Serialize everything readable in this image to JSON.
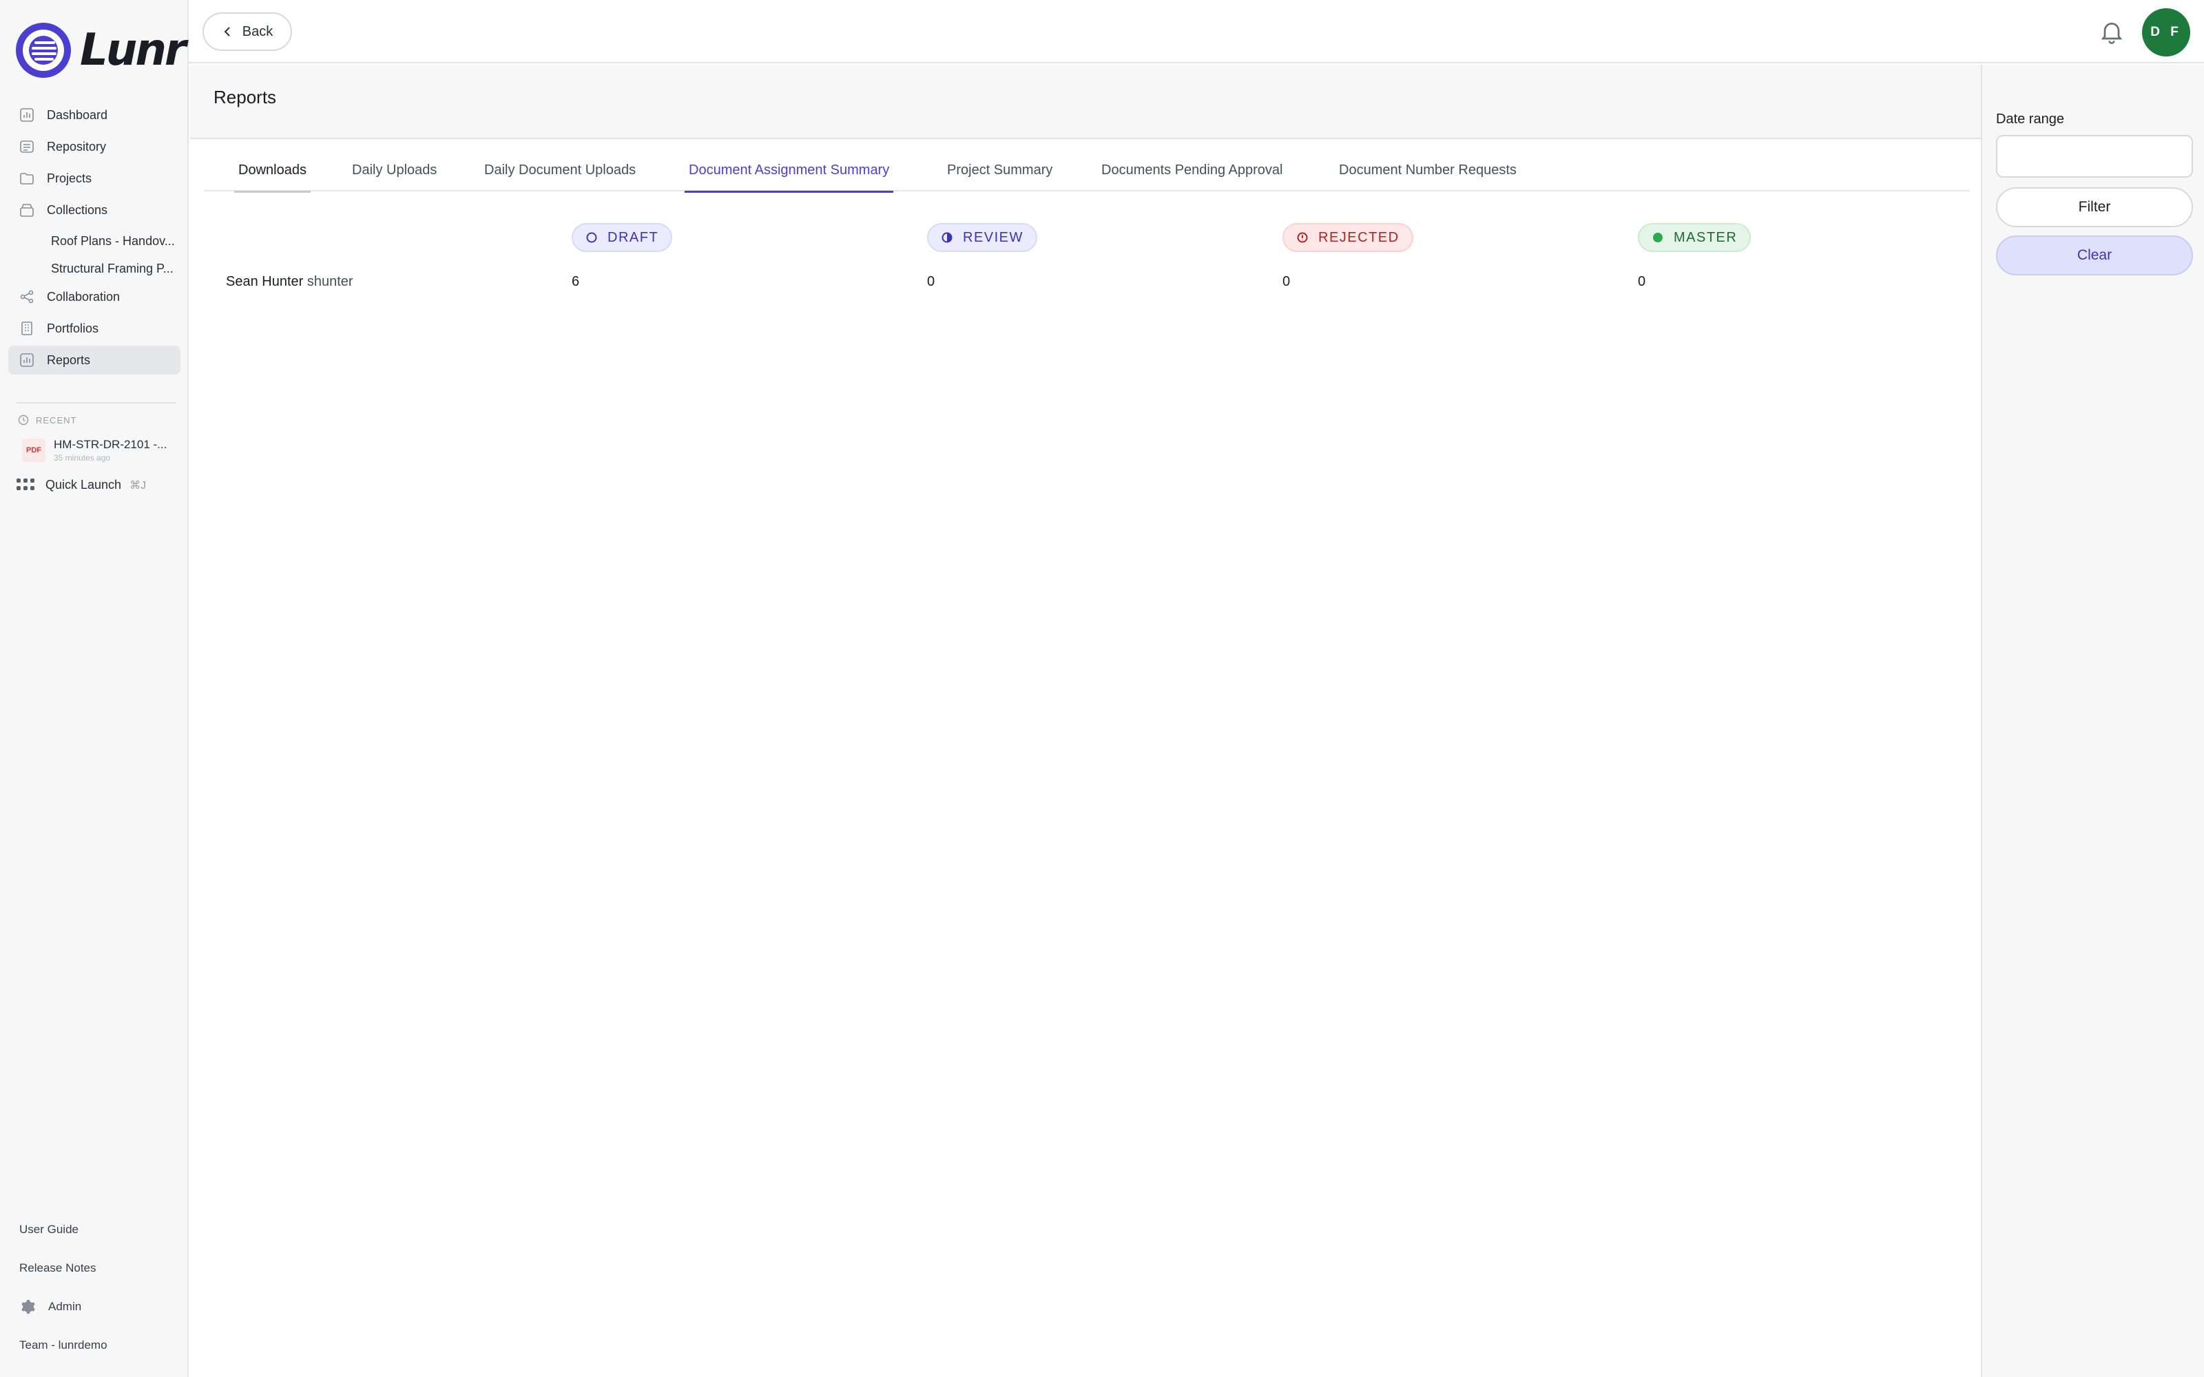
{
  "app": {
    "logo_text": "Lunr",
    "brand_color": "#4a3fd0"
  },
  "sidebar": {
    "items": [
      {
        "label": "Dashboard",
        "icon": "chart-icon"
      },
      {
        "label": "Repository",
        "icon": "repository-icon"
      },
      {
        "label": "Projects",
        "icon": "folder-icon"
      },
      {
        "label": "Collections",
        "icon": "collection-icon"
      },
      {
        "label": "Roof Plans - Handov...",
        "icon": ""
      },
      {
        "label": "Structural Framing P...",
        "icon": ""
      },
      {
        "label": "Collaboration",
        "icon": "share-icon"
      },
      {
        "label": "Portfolios",
        "icon": "building-icon"
      },
      {
        "label": "Reports",
        "icon": "report-icon",
        "active": true
      }
    ],
    "recent": {
      "heading": "RECENT",
      "item": {
        "badge": "PDF",
        "title": "HM-STR-DR-2101 -...",
        "time": "35 minutes ago"
      }
    },
    "quick_launch": {
      "label": "Quick Launch",
      "shortcut": "⌘J"
    },
    "footer": {
      "user_guide": "User Guide",
      "release_notes": "Release Notes",
      "admin": "Admin",
      "team": "Team - lunrdemo"
    }
  },
  "topbar": {
    "back_label": "Back",
    "avatar_initials": "D F",
    "avatar_color": "#1e7a3c"
  },
  "page": {
    "title": "Reports"
  },
  "tabs": [
    {
      "label": "Downloads"
    },
    {
      "label": "Daily Uploads"
    },
    {
      "label": "Daily Document Uploads"
    },
    {
      "label": "Document Assignment Summary",
      "active": true
    },
    {
      "label": "Project Summary"
    },
    {
      "label": "Documents Pending Approval"
    },
    {
      "label": "Document Number Requests"
    }
  ],
  "table": {
    "columns": [
      {
        "label": "DRAFT",
        "color": "#3d33b5"
      },
      {
        "label": "REVIEW",
        "color": "#3d33b5"
      },
      {
        "label": "REJECTED",
        "color": "#b42323"
      },
      {
        "label": "MASTER",
        "color": "#1d6a34"
      }
    ],
    "rows": [
      {
        "name": "Sean Hunter",
        "username": "shunter",
        "values": [
          "6",
          "0",
          "0",
          "0"
        ]
      }
    ]
  },
  "filters": {
    "date_range_label": "Date range",
    "date_range_value": "",
    "filter_label": "Filter",
    "clear_label": "Clear"
  }
}
